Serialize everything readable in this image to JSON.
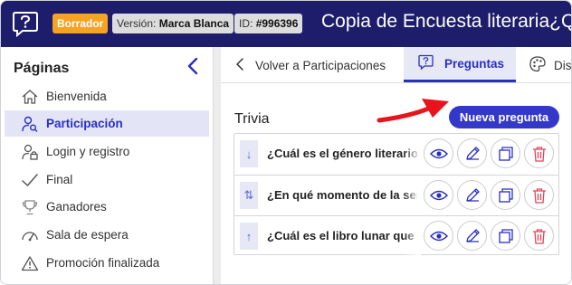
{
  "topbar": {
    "logo_icon": "help-square-icon",
    "draft_badge": "Borrador",
    "version_label": "Versión:",
    "version_value": "Marca Blanca",
    "id_label": "ID:",
    "id_value": "#996396",
    "title": "Copia de Encuesta literaria¿Qué"
  },
  "sidebar": {
    "heading": "Páginas",
    "items": [
      {
        "label": "Bienvenida",
        "icon": "home-icon"
      },
      {
        "label": "Participación",
        "icon": "user-search-icon"
      },
      {
        "label": "Login y registro",
        "icon": "user-lock-icon"
      },
      {
        "label": "Final",
        "icon": "checkmark-icon"
      },
      {
        "label": "Ganadores",
        "icon": "trophy-icon"
      },
      {
        "label": "Sala de espera",
        "icon": "speedometer-icon"
      },
      {
        "label": "Promoción finalizada",
        "icon": "warning-icon"
      }
    ]
  },
  "tabs": {
    "back": "Volver a Participaciones",
    "questions": "Preguntas",
    "design": "Dis"
  },
  "section": {
    "title": "Trivia",
    "new_button": "Nueva pregunta"
  },
  "questions": [
    {
      "text": "¿Cuál es el género literario",
      "handle": "↓"
    },
    {
      "text": "¿En qué momento de la ser",
      "handle": "⇅"
    },
    {
      "text": "¿Cuál es el libro lunar que",
      "handle": "↑"
    }
  ],
  "colors": {
    "navy": "#1d1d6b",
    "accent": "#3438c8",
    "draft": "#f5a323",
    "delete": "#e0435a",
    "arrow": "#e8131c"
  }
}
